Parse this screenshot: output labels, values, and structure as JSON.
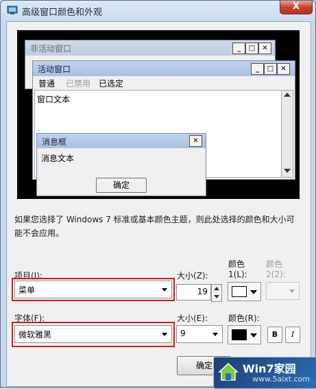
{
  "window": {
    "title": "高级窗口颜色和外观",
    "close_symbol": "X"
  },
  "preview": {
    "inactive_title": "非活动窗口",
    "active_title": "活动窗口",
    "menu": [
      "普通",
      "已禁用",
      "已选定"
    ],
    "window_text": "窗口文本",
    "message_box_title": "消息框",
    "message_text": "消息文本",
    "ok_label": "确定"
  },
  "info_text": "如果您选择了 Windows 7 标准或基本颜色主题，则此处选择的颜色和大小可能不会应用。",
  "item": {
    "label": "项目(I):",
    "value": "菜单",
    "size_label": "大小(Z):",
    "size_value": "19",
    "color1_label_a": "颜色",
    "color1_label_b": "1(L):",
    "color1": "#ffffff",
    "color2_label_a": "颜色",
    "color2_label_b": "2(2):"
  },
  "font": {
    "label": "字体(F):",
    "value": "微软雅黑",
    "size_label": "大小(E):",
    "size_value": "9",
    "color_label": "颜色(R):",
    "color": "#000000",
    "bold_label": "B",
    "italic_label": "I"
  },
  "footer": {
    "ok_label": "确定"
  },
  "watermark": {
    "text": "Win7家园",
    "url": "www.5aixt.com"
  },
  "colors": {
    "highlight_box": "#c62020",
    "close_button": "#c9432e"
  }
}
